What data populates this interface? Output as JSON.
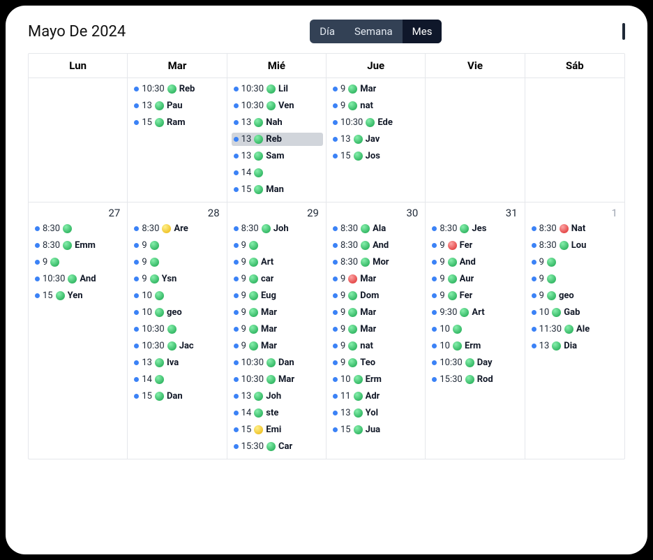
{
  "title": "Mayo De 2024",
  "views": {
    "day": "Día",
    "week": "Semana",
    "month": "Mes",
    "active": "month"
  },
  "day_headers": [
    "Lun",
    "Mar",
    "Mié",
    "Jue",
    "Vie",
    "Sáb"
  ],
  "week1": [
    {
      "date": "",
      "events": []
    },
    {
      "date": "",
      "events": [
        {
          "time": "10:30",
          "status": "green",
          "name": "Reb"
        },
        {
          "time": "13",
          "status": "green",
          "name": "Pau"
        },
        {
          "time": "15",
          "status": "green",
          "name": "Ram"
        }
      ]
    },
    {
      "date": "",
      "events": [
        {
          "time": "10:30",
          "status": "green",
          "name": "Lil"
        },
        {
          "time": "10:30",
          "status": "green",
          "name": "Ven"
        },
        {
          "time": "13",
          "status": "green",
          "name": "Nah"
        },
        {
          "time": "13",
          "status": "green",
          "name": "Reb",
          "selected": true
        },
        {
          "time": "13",
          "status": "green",
          "name": "Sam"
        },
        {
          "time": "14",
          "status": "green",
          "name": ""
        },
        {
          "time": "15",
          "status": "green",
          "name": "Man"
        }
      ]
    },
    {
      "date": "",
      "events": [
        {
          "time": "9",
          "status": "green",
          "name": "Mar"
        },
        {
          "time": "9",
          "status": "green",
          "name": "nat"
        },
        {
          "time": "10:30",
          "status": "green",
          "name": "Ede"
        },
        {
          "time": "13",
          "status": "green",
          "name": "Jav"
        },
        {
          "time": "15",
          "status": "green",
          "name": "Jos"
        }
      ]
    },
    {
      "date": "",
      "events": []
    },
    {
      "date": "",
      "events": []
    }
  ],
  "week2": [
    {
      "date": "27",
      "events": [
        {
          "time": "8:30",
          "status": "green",
          "name": ""
        },
        {
          "time": "8:30",
          "status": "green",
          "name": "Emm"
        },
        {
          "time": "9",
          "status": "green",
          "name": ""
        },
        {
          "time": "10:30",
          "status": "green",
          "name": "And"
        },
        {
          "time": "15",
          "status": "green",
          "name": "Yen"
        }
      ]
    },
    {
      "date": "28",
      "events": [
        {
          "time": "8:30",
          "status": "yellow",
          "name": "Are"
        },
        {
          "time": "9",
          "status": "green",
          "name": ""
        },
        {
          "time": "9",
          "status": "green",
          "name": ""
        },
        {
          "time": "9",
          "status": "green",
          "name": "Ysn"
        },
        {
          "time": "10",
          "status": "green",
          "name": ""
        },
        {
          "time": "10",
          "status": "green",
          "name": "geo"
        },
        {
          "time": "10:30",
          "status": "green",
          "name": ""
        },
        {
          "time": "10:30",
          "status": "green",
          "name": "Jac"
        },
        {
          "time": "13",
          "status": "green",
          "name": "Iva"
        },
        {
          "time": "14",
          "status": "green",
          "name": ""
        },
        {
          "time": "15",
          "status": "green",
          "name": "Dan"
        }
      ]
    },
    {
      "date": "29",
      "events": [
        {
          "time": "8:30",
          "status": "green",
          "name": "Joh"
        },
        {
          "time": "9",
          "status": "green",
          "name": ""
        },
        {
          "time": "9",
          "status": "green",
          "name": "Art"
        },
        {
          "time": "9",
          "status": "green",
          "name": "car"
        },
        {
          "time": "9",
          "status": "green",
          "name": "Eug"
        },
        {
          "time": "9",
          "status": "green",
          "name": "Mar"
        },
        {
          "time": "9",
          "status": "green",
          "name": "Mar"
        },
        {
          "time": "9",
          "status": "green",
          "name": "Mar"
        },
        {
          "time": "10:30",
          "status": "green",
          "name": "Dan"
        },
        {
          "time": "10:30",
          "status": "green",
          "name": "Mar"
        },
        {
          "time": "13",
          "status": "green",
          "name": "Joh"
        },
        {
          "time": "14",
          "status": "green",
          "name": "ste"
        },
        {
          "time": "15",
          "status": "yellow",
          "name": "Emi"
        },
        {
          "time": "15:30",
          "status": "green",
          "name": "Car"
        }
      ]
    },
    {
      "date": "30",
      "events": [
        {
          "time": "8:30",
          "status": "green",
          "name": "Ala"
        },
        {
          "time": "8:30",
          "status": "green",
          "name": "And"
        },
        {
          "time": "8:30",
          "status": "green",
          "name": "Mor"
        },
        {
          "time": "9",
          "status": "red",
          "name": "Mar"
        },
        {
          "time": "9",
          "status": "green",
          "name": "Dom"
        },
        {
          "time": "9",
          "status": "green",
          "name": "Mar"
        },
        {
          "time": "9",
          "status": "green",
          "name": "Mar"
        },
        {
          "time": "9",
          "status": "green",
          "name": "nat"
        },
        {
          "time": "9",
          "status": "green",
          "name": "Teo"
        },
        {
          "time": "10",
          "status": "green",
          "name": "Erm"
        },
        {
          "time": "11",
          "status": "green",
          "name": "Adr"
        },
        {
          "time": "13",
          "status": "green",
          "name": "Yol"
        },
        {
          "time": "15",
          "status": "green",
          "name": "Jua"
        }
      ]
    },
    {
      "date": "31",
      "events": [
        {
          "time": "8:30",
          "status": "green",
          "name": "Jes"
        },
        {
          "time": "9",
          "status": "red",
          "name": "Fer"
        },
        {
          "time": "9",
          "status": "green",
          "name": "And"
        },
        {
          "time": "9",
          "status": "green",
          "name": "Aur"
        },
        {
          "time": "9",
          "status": "green",
          "name": "Fer"
        },
        {
          "time": "9:30",
          "status": "green",
          "name": "Art"
        },
        {
          "time": "10",
          "status": "green",
          "name": ""
        },
        {
          "time": "10",
          "status": "green",
          "name": "Erm"
        },
        {
          "time": "10:30",
          "status": "green",
          "name": "Day"
        },
        {
          "time": "15:30",
          "status": "green",
          "name": "Rod"
        }
      ]
    },
    {
      "date": "1",
      "muted": true,
      "events": [
        {
          "time": "8:30",
          "status": "red",
          "name": "Nat"
        },
        {
          "time": "8:30",
          "status": "green",
          "name": "Lou"
        },
        {
          "time": "9",
          "status": "green",
          "name": ""
        },
        {
          "time": "9",
          "status": "green",
          "name": ""
        },
        {
          "time": "9",
          "status": "green",
          "name": "geo"
        },
        {
          "time": "10",
          "status": "green",
          "name": "Gab"
        },
        {
          "time": "11:30",
          "status": "green",
          "name": "Ale"
        },
        {
          "time": "13",
          "status": "green",
          "name": "Dia"
        }
      ]
    }
  ]
}
